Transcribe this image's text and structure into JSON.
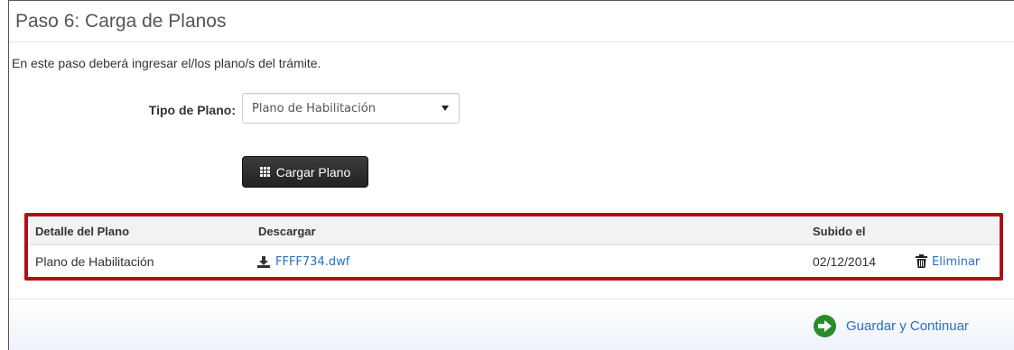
{
  "step": {
    "title": "Paso 6: Carga de Planos",
    "intro": "En este paso deberá ingresar el/los plano/s del trámite."
  },
  "form": {
    "type_label": "Tipo de Plano:",
    "type_selected": "Plano de Habilitación",
    "upload_button": "Cargar Plano"
  },
  "table": {
    "headers": {
      "detail": "Detalle del Plano",
      "download": "Descargar",
      "uploaded": "Subido el"
    },
    "rows": [
      {
        "detail": "Plano de Habilitación",
        "file": "FFFF734.dwf",
        "uploaded": "02/12/2014",
        "delete": "Eliminar"
      }
    ]
  },
  "footer": {
    "save_continue": "Guardar y Continuar"
  },
  "colors": {
    "highlight_border": "#b00f14",
    "link": "#2a6ebb",
    "save_icon": "#2b8a2b"
  }
}
